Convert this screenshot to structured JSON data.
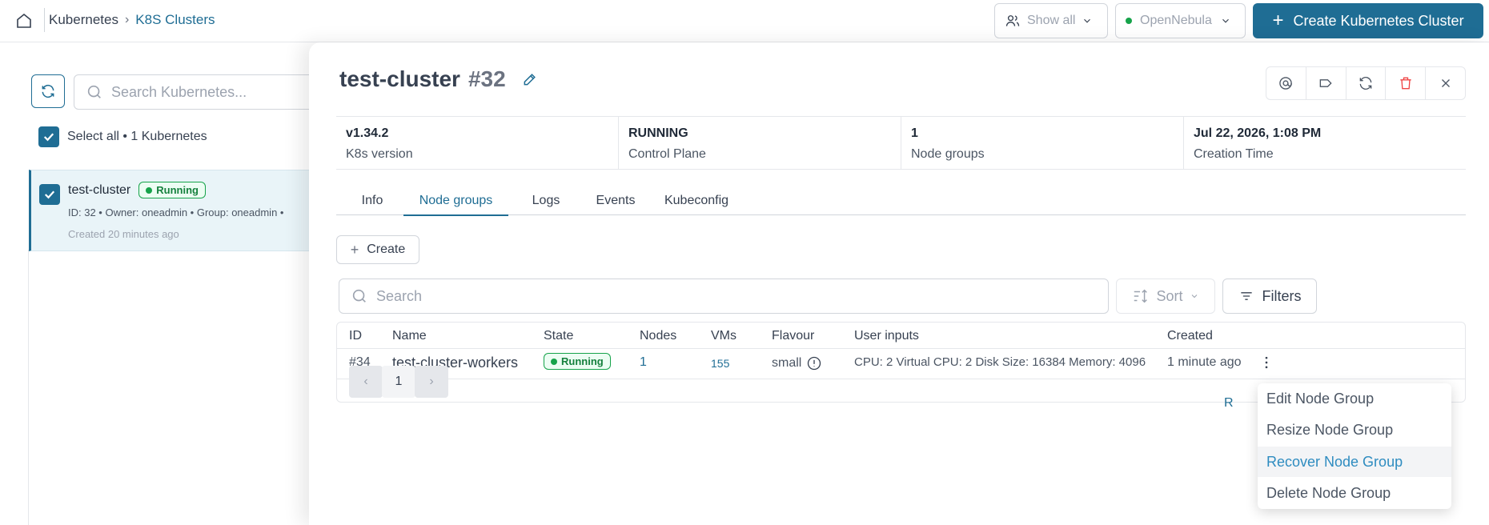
{
  "header": {
    "breadcrumb": {
      "root": "Kubernetes",
      "separator": "›",
      "current": "K8S Clusters"
    },
    "show_all_label": "Show all",
    "cloud_label": "OpenNebula",
    "create_button": "Create Kubernetes Cluster",
    "create_plus": "+"
  },
  "list": {
    "search_placeholder": "Search Kubernetes...",
    "select_all": "Select all • 1 Kubernetes",
    "items": [
      {
        "name": "test-cluster",
        "status": "Running",
        "meta": "ID: 32  •  Owner: oneadmin  •  Group: oneadmin  •",
        "created": "Created 20 minutes ago"
      }
    ]
  },
  "detail": {
    "title": "test-cluster",
    "id": "#32",
    "stats": [
      {
        "value": "v1.34.2",
        "label": "K8s version"
      },
      {
        "value": "RUNNING",
        "label": "Control Plane"
      },
      {
        "value": "1",
        "label": "Node groups"
      },
      {
        "value": "Jul 22, 2026, 1:08 PM",
        "label": "Creation Time"
      }
    ],
    "tabs": [
      "Info",
      "Node groups",
      "Logs",
      "Events",
      "Kubeconfig"
    ],
    "active_tab": "Node groups",
    "create_label": "Create",
    "create_plus": "+",
    "search_placeholder": "Search",
    "sort_label": "Sort",
    "filters_label": "Filters",
    "table": {
      "columns": [
        "ID",
        "Name",
        "State",
        "Nodes",
        "VMs",
        "Flavour",
        "User inputs",
        "Created"
      ],
      "rows": [
        {
          "id": "#34",
          "name": "test-cluster-workers",
          "state": "Running",
          "nodes": "1",
          "vms": "155",
          "flavour": "small",
          "user_inputs": "CPU: 2  Virtual CPU: 2  Disk Size: 16384  Memory: 4096",
          "created": "1 minute ago"
        }
      ]
    },
    "pagination": {
      "prev": "‹",
      "page": "1",
      "next": "›"
    },
    "right_fragment": "R"
  },
  "context_menu": {
    "items": [
      "Edit Node Group",
      "Resize Node Group",
      "Recover Node Group",
      "Delete Node Group"
    ],
    "hovered": "Recover Node Group"
  }
}
